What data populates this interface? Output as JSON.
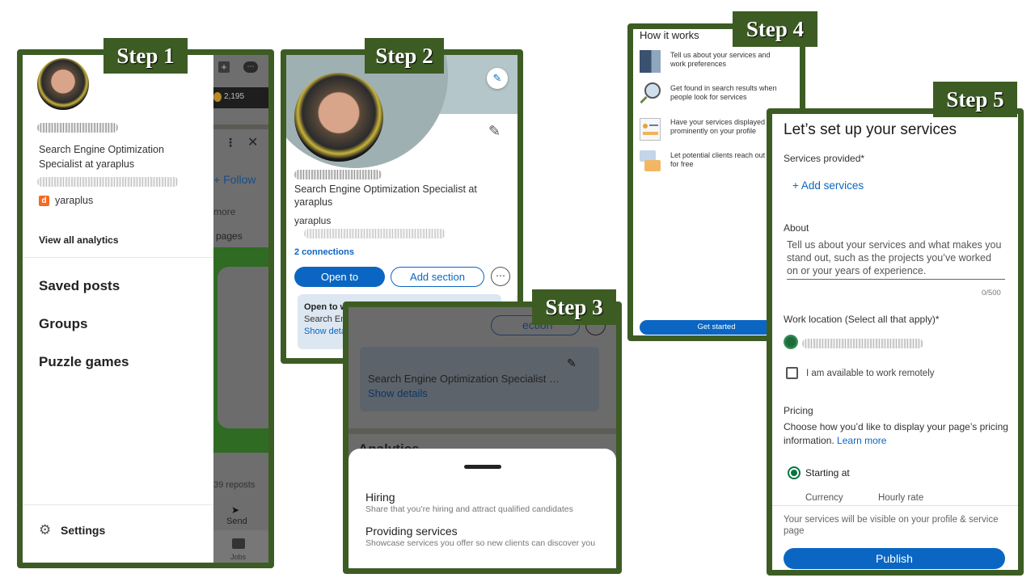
{
  "colors": {
    "frame_green": "#3d5c24",
    "linkedin_blue": "#0a66c2",
    "success_green": "#057642"
  },
  "step1": {
    "label": "Step 1",
    "drawer": {
      "headline": "Search Engine Optimization Specialist at yaraplus",
      "company": "yaraplus",
      "view_analytics": "View all analytics",
      "menu_items": [
        "Saved posts",
        "Groups",
        "Puzzle games"
      ],
      "settings": "Settings"
    },
    "background": {
      "points": "2,195",
      "follow": "+ Follow",
      "more": "more",
      "pages": "pages",
      "reposts": "39 reposts",
      "send": "Send",
      "jobs": "Jobs"
    }
  },
  "step2": {
    "label": "Step 2",
    "headline": "Search Engine Optimization Specialist at yaraplus",
    "company": "yaraplus",
    "connections": "2 connections",
    "open_to_button": "Open to",
    "add_section_button": "Add section",
    "more_button": "⋯",
    "open_to_work": {
      "title": "Open to work",
      "role": "Search Engine Optimization Specialist …",
      "show_details": "Show details"
    }
  },
  "step3": {
    "label": "Step 3",
    "bg_section_btn": "ection",
    "bg_role": "Search Engine Optimization Specialist …",
    "bg_show_details": "Show details",
    "bg_analytics": "Analytics",
    "options": [
      {
        "title": "Hiring",
        "desc": "Share that you’re hiring and attract qualified candidates"
      },
      {
        "title": "Providing services",
        "desc": "Showcase services you offer so new clients can discover you"
      }
    ]
  },
  "step4": {
    "label": "Step 4",
    "title": "How it works",
    "items": [
      {
        "icon": "building-icon",
        "text": "Tell us about your services and work preferences"
      },
      {
        "icon": "magnifier-icon",
        "text": "Get found in search results when people look for services"
      },
      {
        "icon": "profile-card-icon",
        "text": "Have your services displayed prominently on your profile"
      },
      {
        "icon": "chat-bubbles-icon",
        "text": "Let potential clients reach out to you for free"
      }
    ],
    "get_started": "Get started"
  },
  "step5": {
    "label": "Step 5",
    "title": "Let’s set up your services",
    "services_label": "Services provided*",
    "add_services": "+ Add services",
    "about_label": "About",
    "about_placeholder": "Tell us about your services and what makes you stand out, such as the projects you’ve worked on or your years of experience.",
    "char_count": "0/500",
    "work_location_label": "Work location (Select all that apply)*",
    "remote_label": "I am available to work remotely",
    "remote_checked": false,
    "pricing_label": "Pricing",
    "pricing_desc": "Choose how you’d like to display your page’s pricing information.",
    "learn_more": "Learn more",
    "starting_at": "Starting at",
    "starting_at_selected": true,
    "currency": "Currency",
    "hourly_rate": "Hourly rate",
    "visibility_note": "Your services will be visible on your profile & service page",
    "publish": "Publish"
  }
}
